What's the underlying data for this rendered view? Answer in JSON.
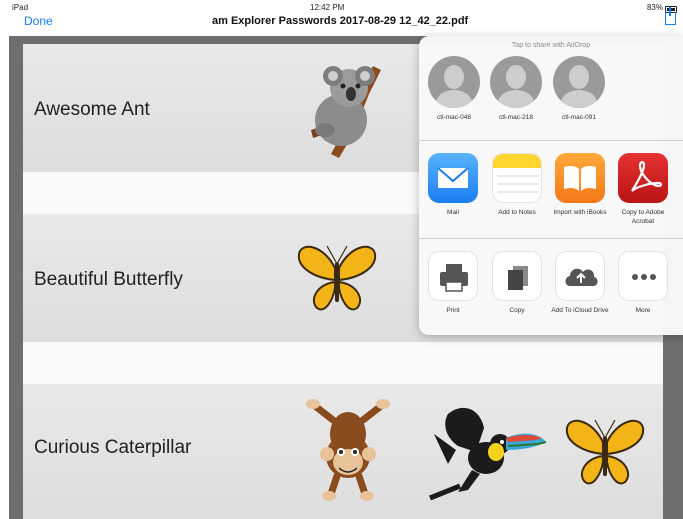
{
  "status_bar": {
    "device": "iPad",
    "time": "12:42 PM",
    "battery": "83%"
  },
  "nav_bar": {
    "done_label": "Done",
    "title": "am Explorer Passwords 2017-08-29 12_42_22.pdf"
  },
  "document": {
    "rows": [
      {
        "label": "Awesome Ant"
      },
      {
        "label": "Beautiful Butterfly"
      },
      {
        "label": "Curious Caterpillar"
      }
    ]
  },
  "share_sheet": {
    "airdrop_hint": "Tap to share with AirDrop",
    "people": [
      {
        "name": "ctl-mac-048"
      },
      {
        "name": "ctl-mac-218"
      },
      {
        "name": "ctl-mac-091"
      }
    ],
    "apps": [
      {
        "label": "Mail",
        "icon": "mail-icon",
        "color": "#2a8ef5"
      },
      {
        "label": "Add to Notes",
        "icon": "notes-icon",
        "color": "#ffd52e"
      },
      {
        "label": "Import with iBooks",
        "icon": "ibooks-icon",
        "color": "#f58a1f"
      },
      {
        "label": "Copy to Adobe Acrobat",
        "icon": "acrobat-icon",
        "color": "#d31f1f"
      }
    ],
    "actions": [
      {
        "label": "Print",
        "icon": "printer-icon"
      },
      {
        "label": "Copy",
        "icon": "copy-icon"
      },
      {
        "label": "Add To iCloud Drive",
        "icon": "icloud-drive-icon"
      },
      {
        "label": "More",
        "icon": "more-icon"
      }
    ]
  }
}
